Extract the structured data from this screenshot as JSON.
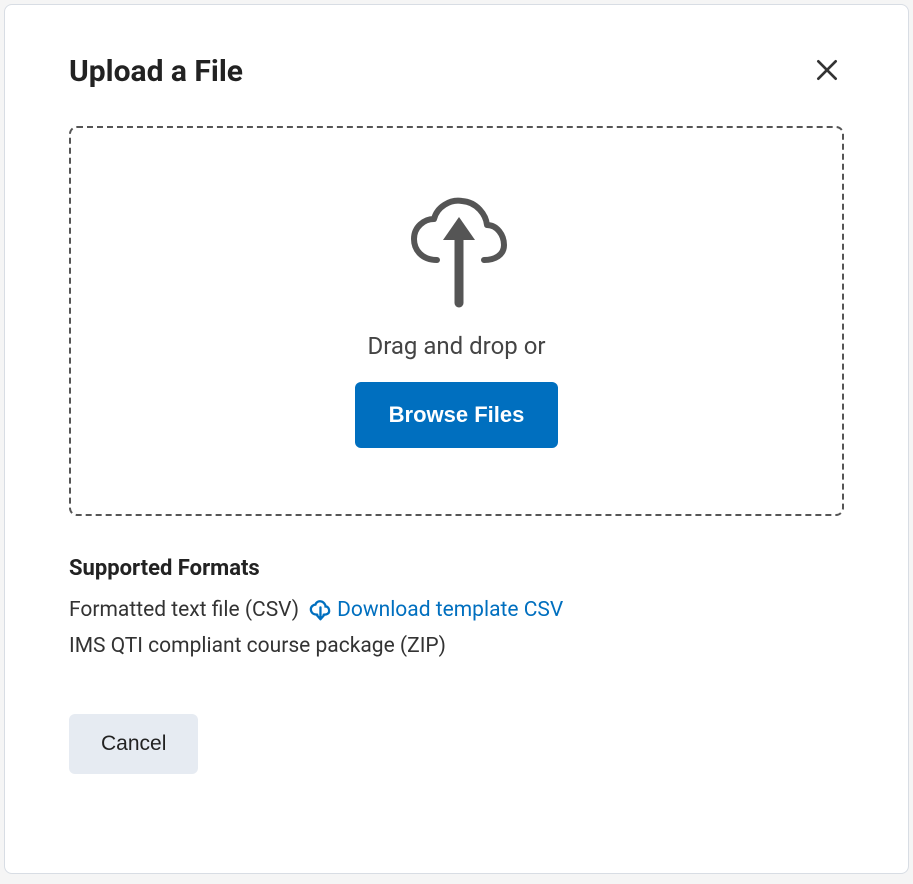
{
  "dialog": {
    "title": "Upload a File"
  },
  "dropzone": {
    "drag_text": "Drag and drop or",
    "browse_label": "Browse Files"
  },
  "supported": {
    "heading": "Supported Formats",
    "format_csv": "Formatted text file (CSV)",
    "download_link_label": "Download template CSV",
    "format_zip": "IMS QTI compliant course package (ZIP)"
  },
  "actions": {
    "cancel_label": "Cancel"
  }
}
